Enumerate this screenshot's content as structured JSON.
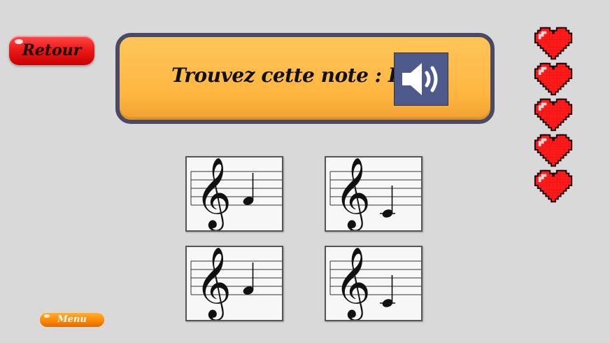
{
  "back_button": {
    "label": "Retour"
  },
  "prompt": {
    "text": "Trouvez cette note : Fa",
    "sound_icon": "speaker-icon"
  },
  "lives": {
    "count": 5,
    "icon": "heart-icon",
    "color": "#ff1a1a"
  },
  "answer_cards": [
    {
      "note_icon": "treble-clef-icon",
      "note_position": "first-space"
    },
    {
      "note_icon": "treble-clef-icon",
      "note_position": "ledger-line-below"
    },
    {
      "note_icon": "treble-clef-icon",
      "note_position": "first-space"
    },
    {
      "note_icon": "treble-clef-icon",
      "note_position": "ledger-line-below"
    }
  ],
  "menu_button": {
    "label": "Menu"
  },
  "colors": {
    "background": "#d9d9d9",
    "banner": "#ffb640",
    "banner_border": "#4a4a66",
    "speaker_button": "#4f5a8c",
    "back_button": "#f01a1a",
    "menu_button": "#ff8a00"
  }
}
